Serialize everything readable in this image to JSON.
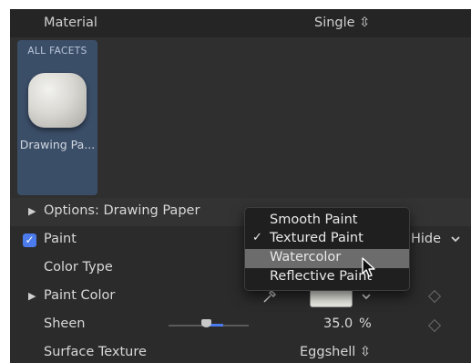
{
  "header": {
    "label": "Material",
    "value": "Single ⇳"
  },
  "swatch": {
    "tag": "ALL FACETS",
    "name": "Drawing Pa..."
  },
  "options": {
    "label": "Options: Drawing Paper"
  },
  "paint": {
    "label": "Paint",
    "hide_label": "Hide"
  },
  "color_type": {
    "label": "Color Type"
  },
  "paint_color": {
    "label": "Paint Color"
  },
  "sheen": {
    "label": "Sheen",
    "value": "35.0",
    "unit": "%",
    "level": 0.35
  },
  "surface_texture": {
    "label": "Surface Texture",
    "value": "Eggshell ⇳"
  },
  "menu": {
    "items": [
      {
        "label": "Smooth Paint",
        "checked": false,
        "highlighted": false
      },
      {
        "label": "Textured Paint",
        "checked": true,
        "highlighted": false
      },
      {
        "label": "Watercolor",
        "checked": false,
        "highlighted": true
      },
      {
        "label": "Reflective Paint",
        "checked": false,
        "highlighted": false
      }
    ]
  },
  "colors": {
    "panel_bg": "#2b2b2b",
    "swatch_bg": "#3b4e68",
    "accent": "#4b7bec",
    "menu_bg": "#1f1f1f",
    "menu_highlight": "#6c6c6c",
    "paint_color": "#ecece6"
  },
  "icons": {
    "disclosure": "disclosure-triangle-icon",
    "eyedropper": "eyedropper-icon",
    "keyframe": "keyframe-diamond-icon",
    "chevron": "chevron-down-icon",
    "cursor": "pointer-cursor-icon"
  }
}
